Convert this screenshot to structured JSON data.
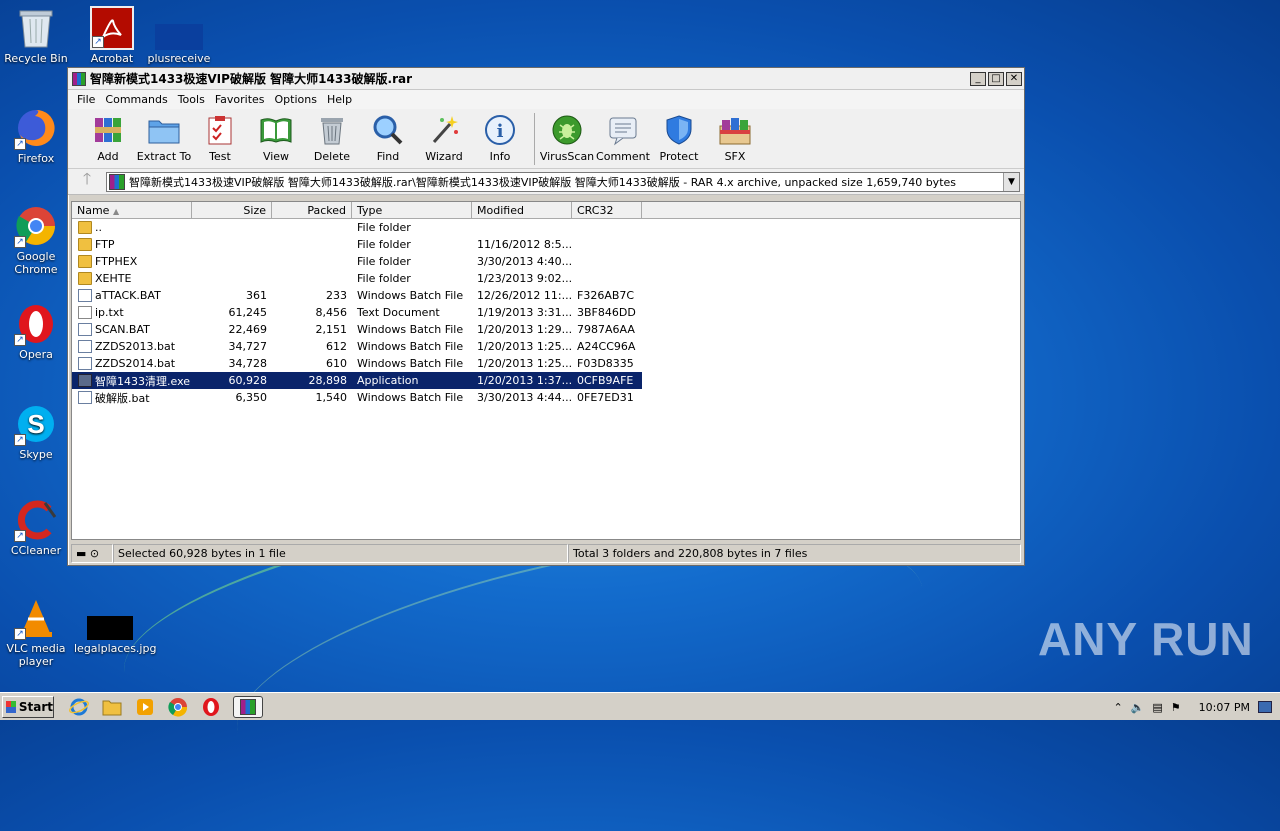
{
  "desktop": {
    "icons": [
      {
        "label": "Recycle Bin"
      },
      {
        "label": "Acrobat"
      },
      {
        "label": "plusreceive"
      },
      {
        "label": "Firefox"
      },
      {
        "label": "Google Chrome"
      },
      {
        "label": "Opera"
      },
      {
        "label": "Skype"
      },
      {
        "label": "CCleaner"
      },
      {
        "label": "VLC media player"
      },
      {
        "label": "legalplaces.jpg"
      }
    ],
    "watermark": "ANY RUN"
  },
  "window": {
    "title": "智障新模式1433极速VIP破解版 智障大师1433破解版.rar",
    "controls": {
      "minimize": "_",
      "maximize": "□",
      "close": "✕"
    },
    "menu": [
      "File",
      "Commands",
      "Tools",
      "Favorites",
      "Options",
      "Help"
    ],
    "toolbar": [
      {
        "label": "Add",
        "icon": "add-icon"
      },
      {
        "label": "Extract To",
        "icon": "extract-icon"
      },
      {
        "label": "Test",
        "icon": "test-icon"
      },
      {
        "label": "View",
        "icon": "view-icon"
      },
      {
        "label": "Delete",
        "icon": "delete-icon"
      },
      {
        "label": "Find",
        "icon": "find-icon"
      },
      {
        "label": "Wizard",
        "icon": "wizard-icon"
      },
      {
        "label": "Info",
        "icon": "info-icon"
      },
      {
        "label": "VirusScan",
        "icon": "virusscan-icon"
      },
      {
        "label": "Comment",
        "icon": "comment-icon"
      },
      {
        "label": "Protect",
        "icon": "protect-icon"
      },
      {
        "label": "SFX",
        "icon": "sfx-icon"
      }
    ],
    "address": "智障新模式1433极速VIP破解版 智障大师1433破解版.rar\\智障新模式1433极速VIP破解版 智障大师1433破解版 - RAR 4.x archive, unpacked size 1,659,740 bytes",
    "columns": {
      "name": "Name",
      "size": "Size",
      "packed": "Packed",
      "type": "Type",
      "modified": "Modified",
      "crc": "CRC32"
    },
    "files": [
      {
        "name": "..",
        "size": "",
        "packed": "",
        "type": "File folder",
        "modified": "",
        "crc": "",
        "kind": "folder"
      },
      {
        "name": "FTP",
        "size": "",
        "packed": "",
        "type": "File folder",
        "modified": "11/16/2012 8:5...",
        "crc": "",
        "kind": "folder"
      },
      {
        "name": "FTPHEX",
        "size": "",
        "packed": "",
        "type": "File folder",
        "modified": "3/30/2013 4:40...",
        "crc": "",
        "kind": "folder"
      },
      {
        "name": "XEHTE",
        "size": "",
        "packed": "",
        "type": "File folder",
        "modified": "1/23/2013 9:02...",
        "crc": "",
        "kind": "folder"
      },
      {
        "name": "aTTACK.BAT",
        "size": "361",
        "packed": "233",
        "type": "Windows Batch File",
        "modified": "12/26/2012 11:...",
        "crc": "F326AB7C",
        "kind": "bat"
      },
      {
        "name": "ip.txt",
        "size": "61,245",
        "packed": "8,456",
        "type": "Text Document",
        "modified": "1/19/2013 3:31...",
        "crc": "3BF846DD",
        "kind": "txt"
      },
      {
        "name": "SCAN.BAT",
        "size": "22,469",
        "packed": "2,151",
        "type": "Windows Batch File",
        "modified": "1/20/2013 1:29...",
        "crc": "7987A6AA",
        "kind": "bat"
      },
      {
        "name": "ZZDS2013.bat",
        "size": "34,727",
        "packed": "612",
        "type": "Windows Batch File",
        "modified": "1/20/2013 1:25...",
        "crc": "A24CC96A",
        "kind": "bat"
      },
      {
        "name": "ZZDS2014.bat",
        "size": "34,728",
        "packed": "610",
        "type": "Windows Batch File",
        "modified": "1/20/2013 1:25...",
        "crc": "F03D8335",
        "kind": "bat"
      },
      {
        "name": "智障1433清理.exe",
        "size": "60,928",
        "packed": "28,898",
        "type": "Application",
        "modified": "1/20/2013 1:37...",
        "crc": "0CFB9AFE",
        "kind": "exe",
        "selected": true
      },
      {
        "name": "破解版.bat",
        "size": "6,350",
        "packed": "1,540",
        "type": "Windows Batch File",
        "modified": "3/30/2013 4:44...",
        "crc": "0FE7ED31",
        "kind": "bat"
      }
    ],
    "status_left": "Selected 60,928 bytes in 1 file",
    "status_right": "Total 3 folders and 220,808 bytes in 7 files"
  },
  "taskbar": {
    "start": "Start",
    "clock": "10:07 PM"
  }
}
